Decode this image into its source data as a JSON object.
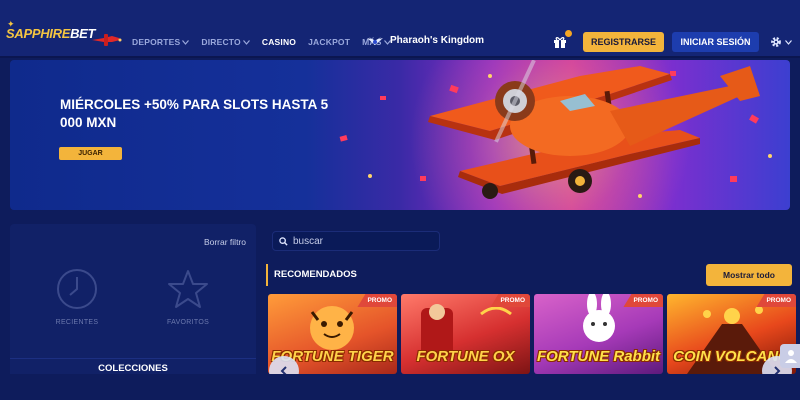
{
  "header": {
    "logo": {
      "part1": "SAPPHIRE",
      "part2": "BET"
    },
    "nav": [
      {
        "label": "DEPORTES",
        "dropdown": true,
        "active": false
      },
      {
        "label": "DIRECTO",
        "dropdown": true,
        "active": false
      },
      {
        "label": "CASINO",
        "dropdown": false,
        "active": true
      },
      {
        "label": "JACKPOT",
        "dropdown": false,
        "active": false
      },
      {
        "label": "MÁS",
        "dropdown": true,
        "active": false
      }
    ],
    "featured_game": "Pharaoh's Kingdom",
    "register_label": "REGISTRARSE",
    "login_label": "INICIAR SESIÓN"
  },
  "banner": {
    "title": "MIÉRCOLES +50% PARA SLOTS HASTA 5 000 MXN",
    "cta_label": "JUGAR"
  },
  "filters": {
    "clear_label": "Borrar filtro",
    "recent_label": "RECIENTES",
    "favorites_label": "FAVORITOS",
    "collections_label": "COLECCIONES"
  },
  "search": {
    "placeholder": "buscar"
  },
  "recommended": {
    "title": "RECOMENDADOS",
    "show_all_label": "Mostrar todo",
    "games": [
      {
        "name": "FORTUNE TIGER",
        "badge": "PROMO"
      },
      {
        "name": "FORTUNE OX",
        "badge": "PROMO"
      },
      {
        "name": "FORTUNE Rabbit",
        "badge": "PROMO"
      },
      {
        "name": "COIN VOLCANO",
        "badge": "PROMO"
      }
    ]
  },
  "colors": {
    "background": "#0e1c5c",
    "header": "#142574",
    "accent": "#f3b43b",
    "login_button": "#1d3dae",
    "promo_badge": "#e0483a"
  }
}
